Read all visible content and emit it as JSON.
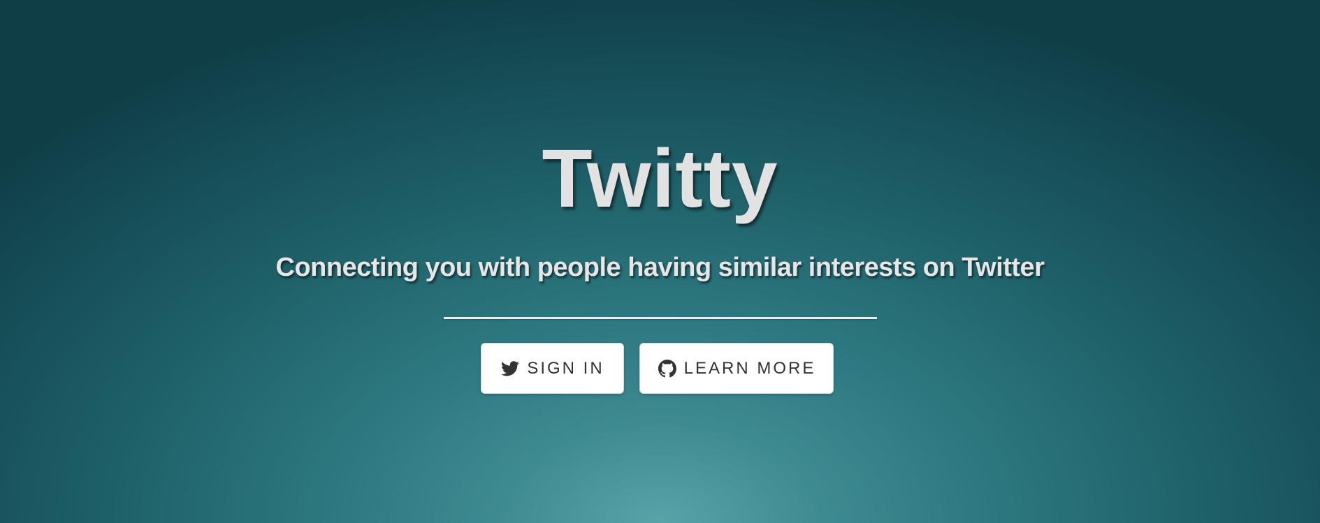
{
  "hero": {
    "title": "Twitty",
    "subtitle": "Connecting you with people having similar interests on Twitter"
  },
  "buttons": {
    "signin": {
      "label": "SIGN IN",
      "icon": "twitter-bird-icon"
    },
    "learn_more": {
      "label": "LEARN MORE",
      "icon": "github-icon"
    }
  },
  "colors": {
    "background_dark": "#103e47",
    "background_light": "#58a3a8",
    "text_light": "#e2e2e2",
    "button_bg": "#ffffff",
    "button_text": "#333333"
  }
}
